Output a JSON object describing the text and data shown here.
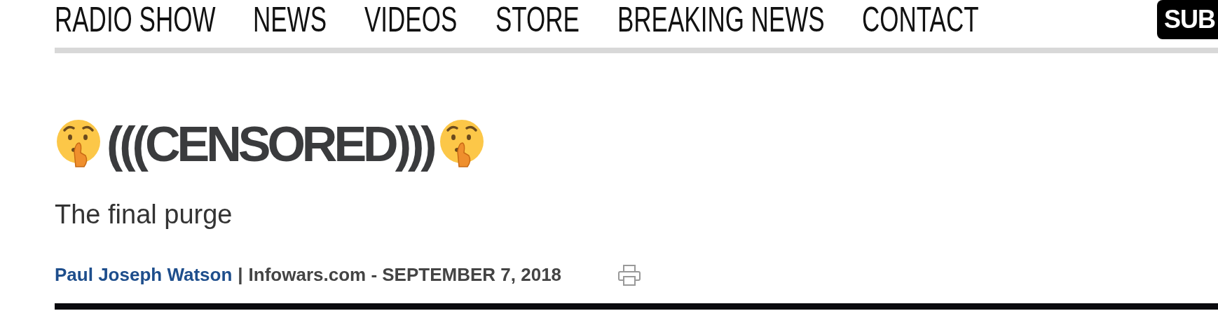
{
  "nav": {
    "items": [
      {
        "label": "RADIO SHOW"
      },
      {
        "label": "NEWS"
      },
      {
        "label": "VIDEOS"
      },
      {
        "label": "STORE"
      },
      {
        "label": "BREAKING NEWS"
      },
      {
        "label": "CONTACT"
      }
    ],
    "subscribe_button": "SUB"
  },
  "article": {
    "title": "(((CENSORED)))",
    "subtitle": "The final purge",
    "author": "Paul Joseph Watson",
    "separator": "|",
    "source": "Infowars.com - SEPTEMBER 7, 2018"
  }
}
